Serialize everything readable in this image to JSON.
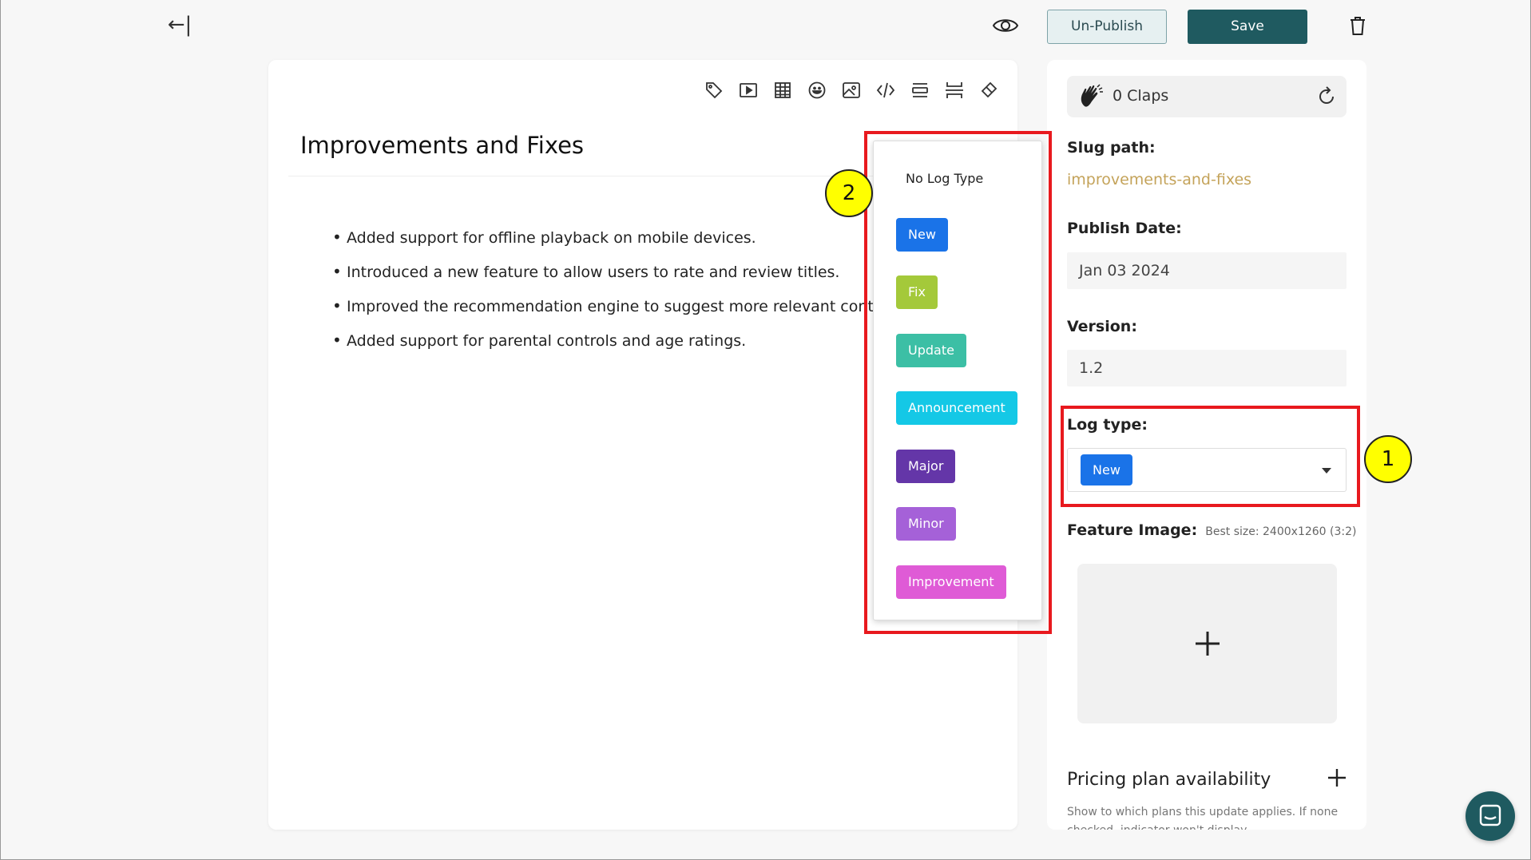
{
  "topbar": {
    "back_icon": "arrow-left-bar-icon",
    "preview_icon": "eye-icon",
    "unpublish_label": "Un-Publish",
    "save_label": "Save",
    "delete_icon": "trash-icon"
  },
  "editor": {
    "toolbar_icons": [
      "tag-icon",
      "video-icon",
      "table-icon",
      "emoji-icon",
      "image-icon",
      "code-icon",
      "divider-icon",
      "section-break-icon",
      "eraser-icon"
    ],
    "title": "Improvements and Fixes",
    "bullets": [
      "Added support for offline playback on mobile devices.",
      "Introduced a new feature to allow users to rate and review titles.",
      "Improved the recommendation engine to suggest more relevant content.",
      "Added support for parental controls and age ratings."
    ]
  },
  "log_type_menu": {
    "items": [
      {
        "label": "No Log Type",
        "color": ""
      },
      {
        "label": "New",
        "color": "#1a73e8"
      },
      {
        "label": "Fix",
        "color": "#a4c93a"
      },
      {
        "label": "Update",
        "color": "#3cbfa5"
      },
      {
        "label": "Announcement",
        "color": "#14c8e6"
      },
      {
        "label": "Major",
        "color": "#6436a8"
      },
      {
        "label": "Minor",
        "color": "#a561d8"
      },
      {
        "label": "Improvement",
        "color": "#df5bd6"
      }
    ]
  },
  "panel": {
    "claps": "0 Claps",
    "slug_label": "Slug path:",
    "slug_value": "improvements-and-fixes",
    "publish_label": "Publish Date:",
    "publish_value": "Jan 03 2024",
    "version_label": "Version:",
    "version_value": "1.2",
    "log_type_label": "Log type:",
    "log_type_value": "New",
    "feature_label": "Feature Image:",
    "feature_hint": "Best size: 2400x1260 (3:2)",
    "pricing_title": "Pricing plan availability",
    "pricing_desc": "Show to which plans this update applies. If none checked, indicator won't display."
  },
  "annotations": {
    "badge_1": "1",
    "badge_2": "2"
  }
}
